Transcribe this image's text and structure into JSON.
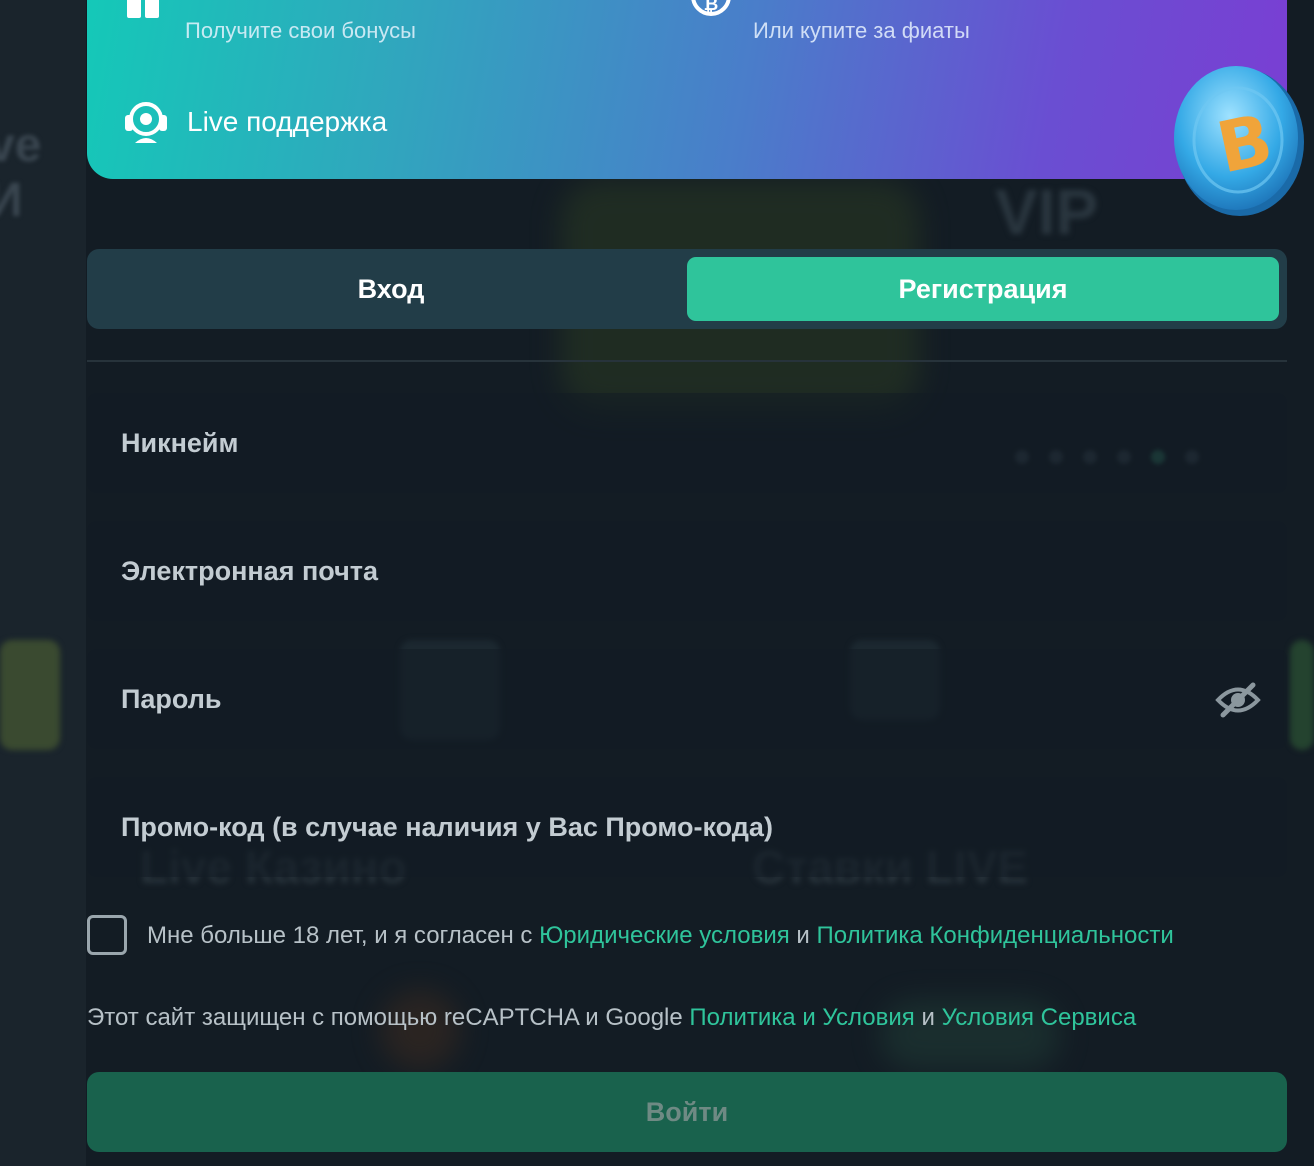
{
  "background": {
    "sidebar_fragment": "ve И",
    "vip_text": "VIP",
    "section_left_title": "Live Казино",
    "section_right_title": "Ставки LIVE"
  },
  "banner": {
    "item1_subtitle": "Получите свои бонусы",
    "item2_subtitle": "Или купите за фиаты",
    "live_support_label": "Live поддержка",
    "icons": [
      "gift-icon",
      "bitcoin-exchange-icon",
      "headset-icon",
      "bitcoin-coin-icon"
    ]
  },
  "tabs": {
    "login": "Вход",
    "register": "Регистрация",
    "active": "register"
  },
  "form": {
    "nickname_label": "Никнейм",
    "email_label": "Электронная почта",
    "password_label": "Пароль",
    "promo_label": "Промо-код (в случае наличия у Вас Промо-кода)"
  },
  "agree": {
    "checked": false,
    "text_before": "Мне больше 18 лет, и я согласен с ",
    "legal_link": "Юридические условия",
    "and_text": " и ",
    "privacy_link": "Политика Конфиденциальности"
  },
  "recaptcha": {
    "text_before": "Этот сайт защищен с помощью reCAPTCHA и Google ",
    "policy_link": "Политика и Условия",
    "and_text": " и ",
    "terms_link": "Условия Сервиса"
  },
  "submit_label": "Войти",
  "colors": {
    "accent": "#2fc49b",
    "tab_track": "#223d48",
    "submit_bg": "#19624d",
    "page_bg": "#131c24"
  }
}
